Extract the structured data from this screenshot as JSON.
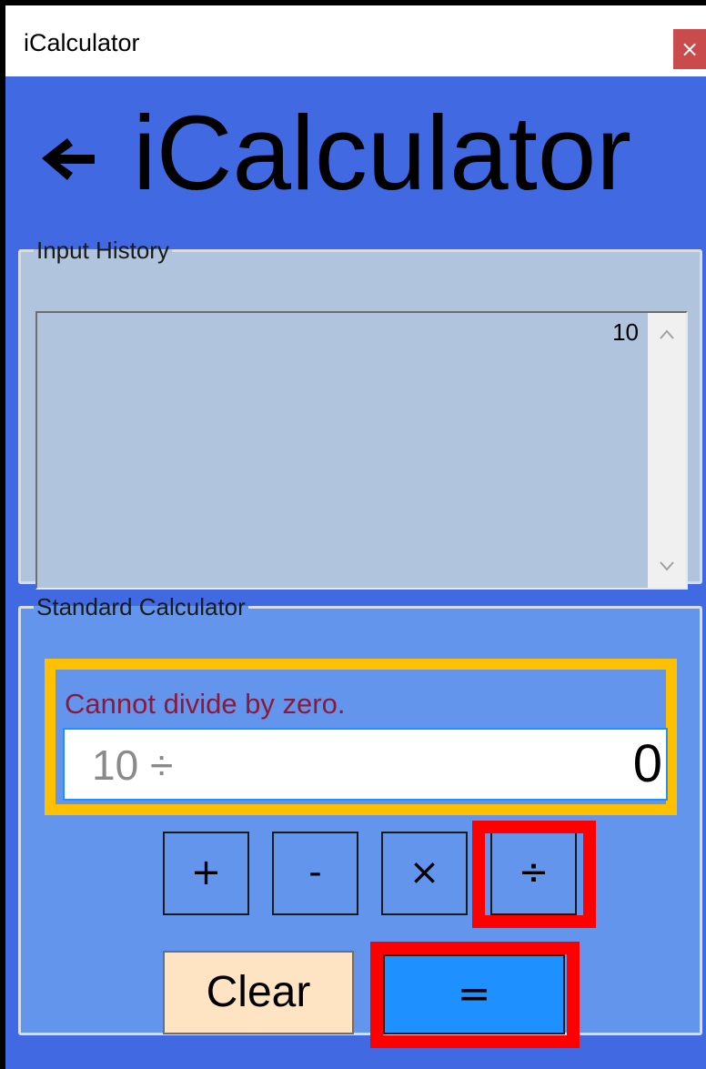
{
  "window": {
    "title": "iCalculator",
    "close_label": "×"
  },
  "header": {
    "title": "iCalculator",
    "back_icon": "arrow-left-icon"
  },
  "history": {
    "legend": "Input History",
    "items": [
      "10"
    ],
    "scroll_up": "^",
    "scroll_down": "v"
  },
  "calculator": {
    "legend": "Standard Calculator",
    "error_message": "Cannot divide by zero.",
    "expression": "10 ÷",
    "current_value": "0",
    "operators": {
      "add": "+",
      "subtract": "-",
      "multiply": "×",
      "divide": "÷"
    },
    "clear_label": "Clear",
    "equals_label": "="
  },
  "colors": {
    "window_background": "#4169E1",
    "history_background": "#B0C4DE",
    "calculator_background": "#6495ED",
    "error_text": "#8B1A3A",
    "clear_button": "#FFE4C4",
    "equals_button": "#1E90FF",
    "highlight_display": "#FFC000",
    "highlight_buttons": "#FF0000"
  }
}
